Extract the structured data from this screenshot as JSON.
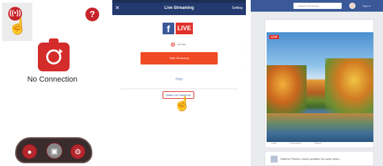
{
  "panel1": {
    "wifi_icon": "wifi-signal-icon",
    "help_glyph": "?",
    "status_text": "No Connection",
    "controls": [
      "record",
      "snapshot",
      "settings"
    ],
    "accent_color": "#c8242b"
  },
  "panel2": {
    "close_glyph": "✕",
    "title": "Live Streaming",
    "settings_label": "Setting",
    "fb_glyph": "f",
    "live_label": "LIVE",
    "radio_label": "Set title",
    "faint_labels": [
      "···",
      "···",
      "···"
    ],
    "start_button_label": "Start Streaming",
    "help_link": "Help",
    "watch_link": "Watch on Facebook",
    "header_color": "#223a6e",
    "live_color": "#e0322c",
    "button_color": "#f04a24"
  },
  "panel3": {
    "search_placeholder": "Search Facebook",
    "signin_label": "Sign in",
    "live_badge": "LIVE",
    "actions": [
      "Like",
      "Comment",
      "Share"
    ],
    "second_post_text": "Gilberto Pinheiro Junior updated his cover photo.",
    "header_color": "#3b5998"
  }
}
